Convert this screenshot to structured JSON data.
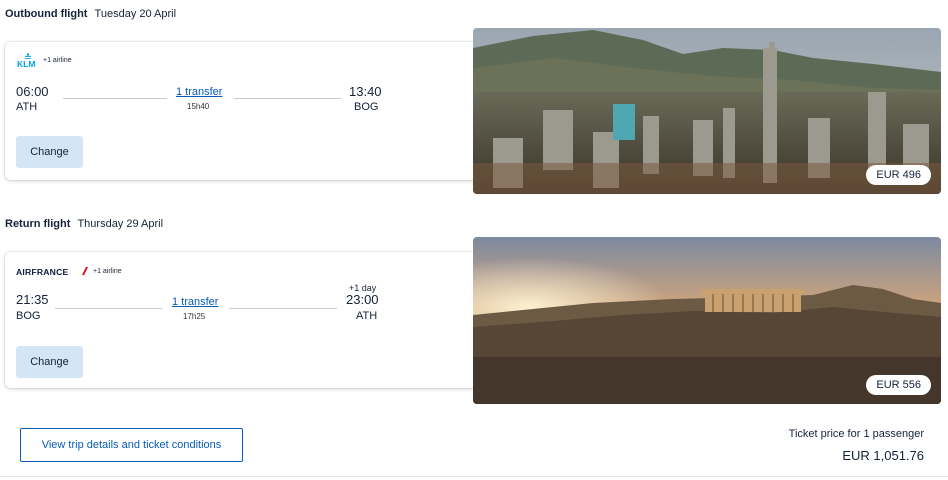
{
  "outbound": {
    "kind": "Outbound flight",
    "date": "Tuesday 20 April",
    "airline_logo": "KLM",
    "airline_extra": "+1 airline",
    "depart_time": "06:00",
    "depart_code": "ATH",
    "transfer": "1 transfer",
    "duration": "15h40",
    "arrive_time": "13:40",
    "arrive_code": "BOG",
    "change_label": "Change",
    "price": "EUR 496",
    "photo_icon": "city-skyline-photo"
  },
  "return": {
    "kind": "Return flight",
    "date": "Thursday 29 April",
    "airline_logo": "AIRFRANCE",
    "airline_extra": "+1 airline",
    "depart_time": "21:35",
    "depart_code": "BOG",
    "transfer": "1 transfer",
    "duration": "17h25",
    "plus_day": "+1 day",
    "arrive_time": "23:00",
    "arrive_code": "ATH",
    "change_label": "Change",
    "price": "EUR 556",
    "photo_icon": "acropolis-photo"
  },
  "footer": {
    "details_label": "View trip details and ticket conditions",
    "ticket_price_label": "Ticket price for 1 passenger",
    "total_price": "EUR 1,051.76"
  },
  "colors": {
    "link": "#0a5bb8",
    "button_bg": "#d4e5f6",
    "text": "#14223a",
    "klm_blue": "#00a1de",
    "airfrance_red": "#e0001b"
  }
}
